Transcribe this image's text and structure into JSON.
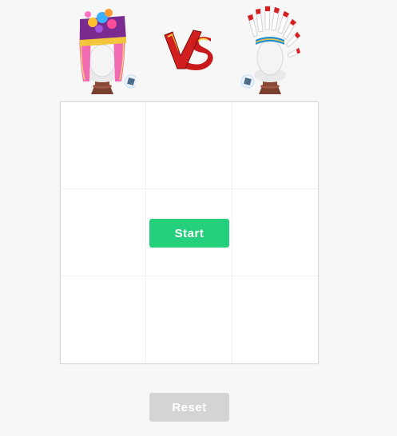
{
  "header": {
    "player_left": {
      "avatar": "pink-feathered-headdress-avatar",
      "badge": "roblox-badge-icon"
    },
    "versus": {
      "logo": "vs-logo",
      "text": "VS"
    },
    "player_right": {
      "avatar": "feather-war-bonnet-avatar",
      "badge": "roblox-badge-icon"
    }
  },
  "board": {
    "rows": 3,
    "columns": 3,
    "cells": [
      "",
      "",
      "",
      "",
      "",
      "",
      "",
      "",
      ""
    ]
  },
  "controls": {
    "start_label": "Start",
    "reset_label": "Reset"
  },
  "colors": {
    "start_button": "#25d07d",
    "reset_button": "#d4d4d4",
    "background": "#f7f7f7",
    "vs_red": "#d11f1f"
  }
}
